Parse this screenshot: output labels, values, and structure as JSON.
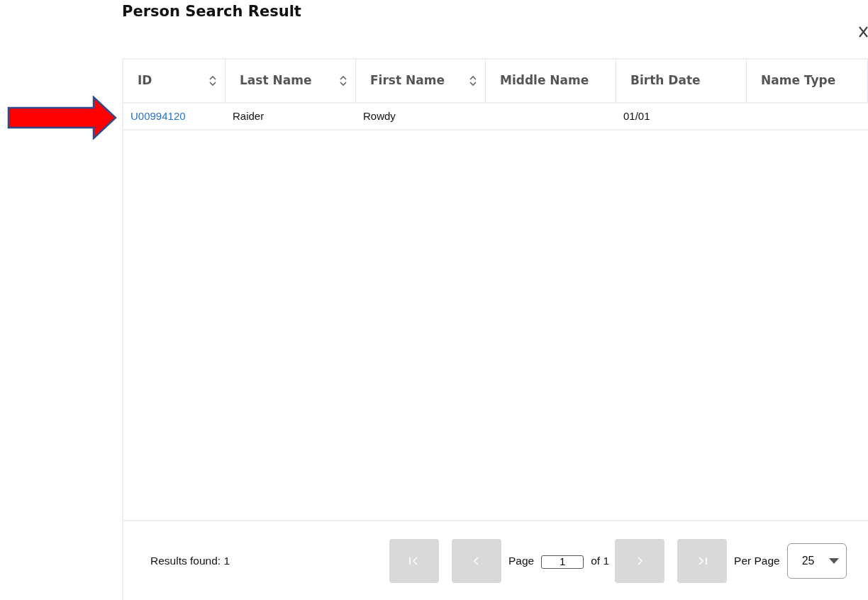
{
  "dialog": {
    "title": "Person Search Result"
  },
  "annotation": {
    "kind": "arrow"
  },
  "table": {
    "columns": [
      {
        "label": "ID",
        "sortable": true
      },
      {
        "label": "Last Name",
        "sortable": true
      },
      {
        "label": "First Name",
        "sortable": true
      },
      {
        "label": "Middle Name",
        "sortable": false
      },
      {
        "label": "Birth Date",
        "sortable": false
      },
      {
        "label": "Name Type",
        "sortable": false
      }
    ],
    "rows": [
      {
        "cells": [
          "U00994120",
          "Raider",
          "Rowdy",
          "",
          "01/01",
          ""
        ]
      }
    ]
  },
  "footer": {
    "results": "Results found: 1",
    "pager": {
      "first": {
        "disabled": true
      },
      "prev": {
        "disabled": true
      },
      "page_label": "Page",
      "page_value": "1",
      "of_label": "of 1",
      "next": {
        "disabled": true
      },
      "last": {
        "disabled": true
      }
    },
    "per_page_label": "Per Page",
    "per_page_value": "25"
  }
}
